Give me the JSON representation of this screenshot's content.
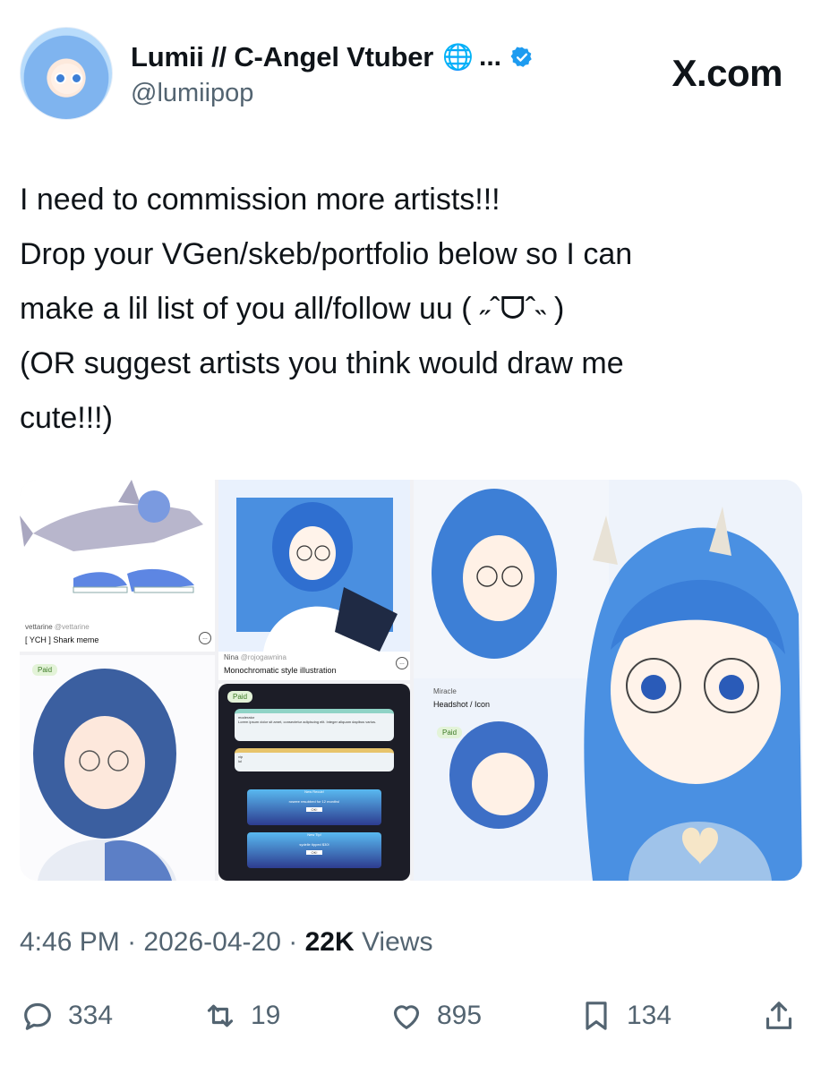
{
  "author": {
    "display_name": "Lumii // C-Angel Vtuber",
    "name_icon": "globe-icon",
    "truncation": "...",
    "handle": "@lumiipop",
    "verified": true
  },
  "site_label": "X.com",
  "tweet": {
    "lines": [
      "I need to commission more artists!!!",
      "Drop your VGen/skeb/portfolio below so I can",
      "make a lil list of you all/follow uu ( ˶ˆᗜˆ˵ )",
      "(OR suggest artists you think would draw me",
      "cute!!!)"
    ]
  },
  "media": {
    "card1": {
      "user": "vettarine",
      "handle": "@vettarine",
      "title": "[ YCH ] Shark meme"
    },
    "card2": {
      "paid": "Paid"
    },
    "card3": {
      "user": "Nina",
      "handle": "@rojogawnina",
      "title": "Monochromatic style illustration"
    },
    "card4": {
      "paid": "Paid",
      "line1": "moderator",
      "line2": "Lorem ipsum dolor sit amet, consectetur adipiscing elit. Integer aliquam dapibus varius.",
      "line3": "vip",
      "line4": "lol",
      "alert1_title": "New Recub!",
      "alert1_text": "roseee resubbed for 12 months!",
      "alert1_btn": "OK!",
      "alert2_title": "New Tip!",
      "alert2_text": "sydelle tipped $30!",
      "alert2_btn": "OK!"
    },
    "card5": {
      "user": "Miracle",
      "title": "Headshot / Icon",
      "paid": "Paid"
    }
  },
  "meta": {
    "time": "4:46 PM",
    "sep": "·",
    "date": "2026-04-20",
    "views_count": "22K",
    "views_label": "Views"
  },
  "actions": {
    "replies": "334",
    "reposts": "19",
    "likes": "895",
    "bookmarks": "134"
  },
  "colors": {
    "verified_blue": "#1d9bf0",
    "secondary_text": "#536471",
    "primary_text": "#0f1419",
    "art_blue": "#4a8fe0"
  }
}
